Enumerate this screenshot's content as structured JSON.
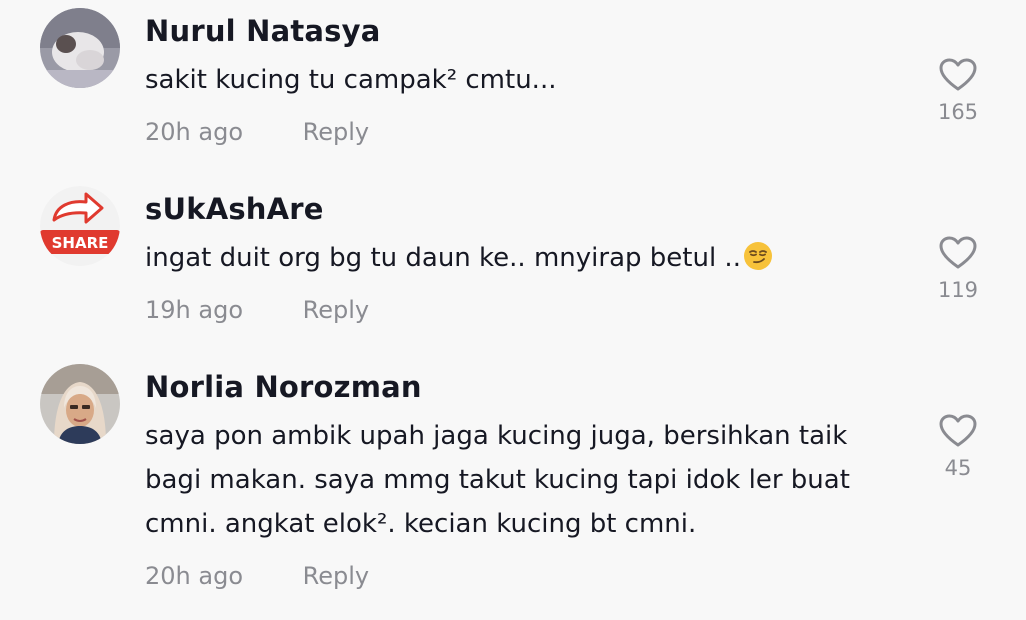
{
  "comments": [
    {
      "username": "Nurul Natasya",
      "text": "sakit kucing tu campak² cmtu...",
      "time": "20h ago",
      "reply_label": "Reply",
      "likes": "165",
      "avatar": "cat-photo-avatar"
    },
    {
      "username": "sUkAshAre",
      "text": "ingat duit org bg tu daun ke.. mnyirap betul ..",
      "emoji": "smirking-face-emoji",
      "time": "19h ago",
      "reply_label": "Reply",
      "likes": "119",
      "avatar": "share-logo-avatar",
      "avatar_text": "SHARE"
    },
    {
      "username": "Norlia Norozman",
      "text": "saya pon ambik upah jaga kucing juga, bersihkan taik bagi makan. saya mmg takut kucing tapi idok ler buat cmni. angkat elok². kecian kucing bt cmni.",
      "time": "20h ago",
      "reply_label": "Reply",
      "likes": "45",
      "avatar": "person-photo-avatar"
    }
  ],
  "colors": {
    "background": "#f8f8f8",
    "username": "#161823",
    "secondary": "#8a8b91",
    "share_red": "#e03a2f"
  }
}
